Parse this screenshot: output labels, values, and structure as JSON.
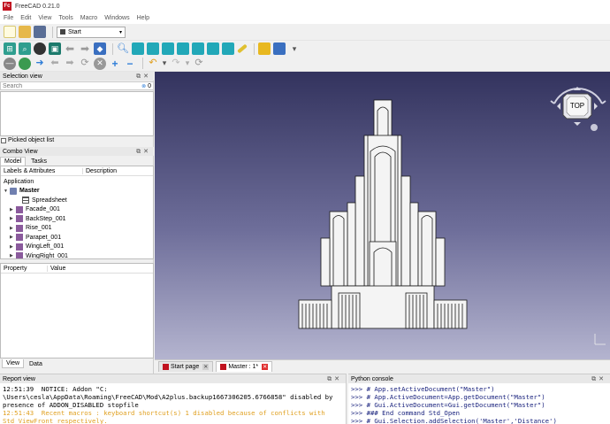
{
  "app": {
    "title": "FreeCAD 0.21.0",
    "logo_text": "Fc"
  },
  "menu": [
    "File",
    "Edit",
    "View",
    "Tools",
    "Macro",
    "Windows",
    "Help"
  ],
  "workbench": {
    "selected": "Start"
  },
  "selection_view": {
    "title": "Selection view",
    "search_placeholder": "Search",
    "count": "0",
    "picked_list_label": "Picked object list"
  },
  "combo_view": {
    "title": "Combo View",
    "tabs": [
      "Model",
      "Tasks"
    ],
    "columns": [
      "Labels & Attributes",
      "Description"
    ],
    "root_label": "Application",
    "document": "Master",
    "items": [
      "Spreadsheet",
      "Facade_001",
      "BackStep_001",
      "Rise_001",
      "Parapet_001",
      "WingLeft_001",
      "WingRight_001"
    ],
    "property_columns": [
      "Property",
      "Value"
    ],
    "bottom_tabs": [
      "View",
      "Data"
    ]
  },
  "navcube": {
    "face": "TOP"
  },
  "doc_tabs": [
    {
      "label": "Start page",
      "active": false
    },
    {
      "label": "Master : 1*",
      "active": true
    }
  ],
  "report_view": {
    "title": "Report view",
    "lines": [
      {
        "text": "12:51:39  NOTICE: Addon \"C:",
        "color": "#000000"
      },
      {
        "text": "\\Users\\cesla\\AppData\\Roaming\\FreeCAD\\Mod\\A2plus.backup1667306205.6766858\" disabled by",
        "color": "#000000"
      },
      {
        "text": "presence of ADDON_DISABLED stopfile",
        "color": "#000000"
      },
      {
        "text": "12:51:43  Recent macros : keyboard shortcut(s) 1 disabled because of conflicts with",
        "color": "#e0a020"
      },
      {
        "text": "Std_ViewFront respectively.",
        "color": "#e0a020"
      }
    ]
  },
  "python_console": {
    "title": "Python console",
    "lines": [
      ">>> # App.setActiveDocument(\"Master\")",
      ">>> # App.ActiveDocument=App.getDocument(\"Master\")",
      ">>> # Gui.ActiveDocument=Gui.getDocument(\"Master\")",
      ">>> ### End command Std_Open",
      ">>> # Gui.Selection.addSelection('Master','Distance')"
    ]
  },
  "colors": {
    "accent": "#c1121f",
    "viewport_top": "#33335e",
    "viewport_bottom": "#b4b4cf",
    "console_prompt": "#2e8b57",
    "console_text": "#1a237e"
  }
}
